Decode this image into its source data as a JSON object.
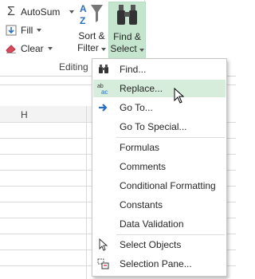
{
  "ribbon": {
    "autosum_label": "AutoSum",
    "fill_label": "Fill",
    "clear_label": "Clear",
    "sort_filter_line1": "Sort &",
    "sort_filter_line2": "Filter",
    "find_select_line1": "Find &",
    "find_select_line2": "Select",
    "group_label": "Editing"
  },
  "sheet": {
    "column_header": "H"
  },
  "menu": {
    "items": [
      {
        "label": "Find...",
        "icon": "binoculars-icon"
      },
      {
        "label": "Replace...",
        "icon": "replace-icon",
        "highlighted": true
      },
      {
        "label": "Go To...",
        "icon": "arrow-right-icon"
      },
      {
        "label": "Go To Special...",
        "icon": ""
      },
      {
        "label": "Formulas",
        "icon": ""
      },
      {
        "label": "Comments",
        "icon": ""
      },
      {
        "label": "Conditional Formatting",
        "icon": ""
      },
      {
        "label": "Constants",
        "icon": ""
      },
      {
        "label": "Data Validation",
        "icon": ""
      },
      {
        "label": "Select Objects",
        "icon": "select-objects-icon"
      },
      {
        "label": "Selection Pane...",
        "icon": "selection-pane-icon"
      }
    ]
  },
  "colors": {
    "accent_green": "#c5e5cf",
    "hover_green": "#d6eddb",
    "arrow_blue": "#2b6fc1",
    "eraser_red": "#d94a5a"
  }
}
